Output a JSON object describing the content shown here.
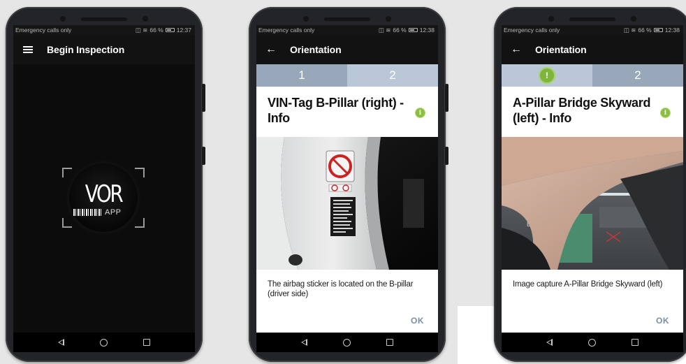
{
  "status": {
    "carrier": "Emergency calls only",
    "battery": [
      "66 %",
      "66 %",
      "66 %"
    ],
    "times": [
      "12:37",
      "12:38",
      "12:38"
    ]
  },
  "screen1": {
    "title": "Begin Inspection",
    "logo_main": "VOR",
    "logo_sub": "APP"
  },
  "screen2": {
    "title": "Orientation",
    "steps": [
      "1",
      "2"
    ],
    "card_title": "VIN-Tag B-Pillar (right) - Info",
    "card_text": "The airbag sticker is located on the B-pillar (driver side)",
    "ok": "OK"
  },
  "screen3": {
    "title": "Orientation",
    "steps": [
      "!",
      "2"
    ],
    "card_title": "A-Pillar Bridge Skyward (left) - Info",
    "card_text": "Image capture A-Pillar Bridge Skyward (left)",
    "ok": "OK"
  },
  "colors": {
    "step_active": "#98a7b9",
    "step_inactive": "#b9c7d6",
    "info_green": "#8bbf3f",
    "ok_text": "#7d8fa5"
  },
  "icons": [
    "menu-icon",
    "back-arrow-icon",
    "info-icon",
    "warning-icon",
    "nav-back-icon",
    "nav-home-icon",
    "nav-recents-icon",
    "wifi-icon",
    "battery-icon"
  ]
}
